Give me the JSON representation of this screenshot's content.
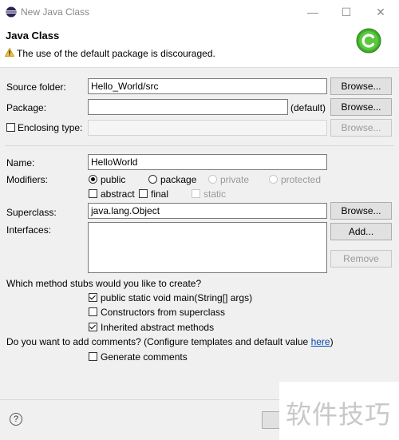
{
  "window": {
    "title": "New Java Class",
    "minimize": "—",
    "maximize": "☐",
    "close": "✕"
  },
  "header": {
    "heading": "Java Class",
    "warning": "The use of the default package is discouraged."
  },
  "form": {
    "source_folder": {
      "label": "Source folder:",
      "value": "Hello_World/src",
      "button": "Browse..."
    },
    "package": {
      "label": "Package:",
      "value": "",
      "suffix": "(default)",
      "button": "Browse..."
    },
    "enclosing_type": {
      "label": "Enclosing type:",
      "value": "",
      "button": "Browse...",
      "checked": false
    },
    "name": {
      "label": "Name:",
      "value": "HelloWorld"
    },
    "modifiers": {
      "label": "Modifiers:",
      "access": [
        "public",
        "package",
        "private",
        "protected"
      ],
      "selected": "public",
      "others": [
        "abstract",
        "final",
        "static"
      ]
    },
    "superclass": {
      "label": "Superclass:",
      "value": "java.lang.Object",
      "button": "Browse..."
    },
    "interfaces": {
      "label": "Interfaces:",
      "add_button": "Add...",
      "remove_button": "Remove"
    }
  },
  "stubs": {
    "question": "Which method stubs would you like to create?",
    "items": [
      {
        "label": "public static void main(String[] args)",
        "checked": true
      },
      {
        "label": "Constructors from superclass",
        "checked": false
      },
      {
        "label": "Inherited abstract methods",
        "checked": true
      }
    ]
  },
  "comments": {
    "question": "Do you want to add comments? (Configure templates and default value ",
    "link": "here",
    "closing": ")",
    "generate": "Generate comments",
    "checked": false
  },
  "footer": {
    "help": "?"
  },
  "watermark": "软件技巧"
}
